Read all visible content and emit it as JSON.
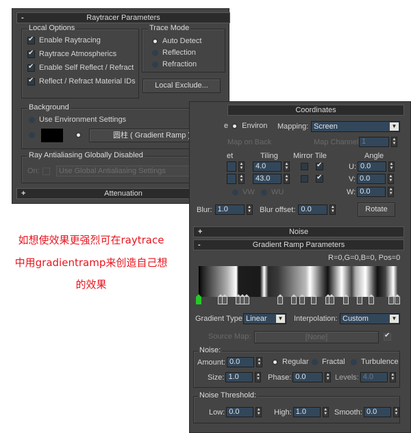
{
  "raytracer": {
    "title": "Raytracer Parameters",
    "collapse_symbol": "-",
    "local_options": {
      "title": "Local Options",
      "items": [
        {
          "label": "Enable Raytracing",
          "checked": true
        },
        {
          "label": "Raytrace Atmospherics",
          "checked": true
        },
        {
          "label": "Enable Self Reflect / Refract",
          "checked": true
        },
        {
          "label": "Reflect / Refract Material IDs",
          "checked": true
        }
      ]
    },
    "trace_mode": {
      "title": "Trace Mode",
      "options": [
        {
          "label": "Auto Detect",
          "selected": true
        },
        {
          "label": "Reflection",
          "selected": false
        },
        {
          "label": "Refraction",
          "selected": false
        }
      ]
    },
    "local_exclude_label": "Local Exclude...",
    "background": {
      "title": "Background",
      "use_env_label": "Use Environment Settings",
      "color_swatch": "#000000",
      "map_button_label": "圆柱 ( Gradient Ramp )"
    },
    "antialiasing": {
      "title": "Ray Antialiasing Globally Disabled",
      "on_label": "On:",
      "dropdown_value": "Use Global Antialiasing Settings",
      "more_button": "..."
    },
    "attenuation_label": "Attenuation",
    "expand_symbol": "+"
  },
  "annotation": {
    "line1": "如想使效果更强烈可在raytrace",
    "line2": "中用gradientramp来创造自己想",
    "line3": "的效果",
    "color": "#e8141e"
  },
  "coordinates": {
    "title": "Coordinates",
    "tex_partial": "e",
    "environ_label": "Environ",
    "mapping_label": "Mapping:",
    "mapping_value": "Screen",
    "map_on_back": "Map on Back",
    "map_channel_label": "Map Channel:",
    "map_channel_value": "1",
    "offset_partial": "et",
    "tiling_label": "Tiling",
    "mirror_tile_label": "Mirror Tile",
    "angle_label": "Angle",
    "tiling_u": "4.0",
    "tiling_v": "43.0",
    "mirror_u": false,
    "tile_u": true,
    "mirror_v": false,
    "tile_v": true,
    "angle_u_label": "U:",
    "angle_u": "0.0",
    "angle_v_label": "V:",
    "angle_v": "0.0",
    "angle_w_label": "W:",
    "angle_w": "0.0",
    "vw_label": "VW",
    "wu_label": "WU",
    "blur_label": "Blur:",
    "blur_value": "1.0",
    "blur_offset_label": "Blur offset:",
    "blur_offset_value": "0.0",
    "rotate_label": "Rotate"
  },
  "noise_rollout": {
    "title": "Noise",
    "symbol": "+"
  },
  "gradient_ramp": {
    "title": "Gradient Ramp Parameters",
    "symbol": "-",
    "readout": "R=0,G=0,B=0, Pos=0",
    "flag_positions_pct": [
      0,
      11,
      13,
      20,
      22,
      24,
      41,
      48,
      52,
      58,
      65,
      67,
      74,
      81,
      87,
      97,
      100
    ],
    "gradient_type_label": "Gradient Type:",
    "gradient_type_value": "Linear",
    "interpolation_label": "Interpolation:",
    "interpolation_value": "Custom",
    "source_map_label": "Source Map:",
    "source_map_value": "[None]",
    "noise": {
      "title": "Noise:",
      "amount_label": "Amount:",
      "amount": "0.0",
      "regular": "Regular",
      "fractal": "Fractal",
      "turbulence": "Turbulence",
      "size_label": "Size:",
      "size": "1.0",
      "phase_label": "Phase:",
      "phase": "0.0",
      "levels_label": "Levels:",
      "levels": "4.0"
    },
    "threshold": {
      "title": "Noise Threshold:",
      "low_label": "Low:",
      "low": "0.0",
      "high_label": "High:",
      "high": "1.0",
      "smooth_label": "Smooth:",
      "smooth": "0.0"
    }
  }
}
